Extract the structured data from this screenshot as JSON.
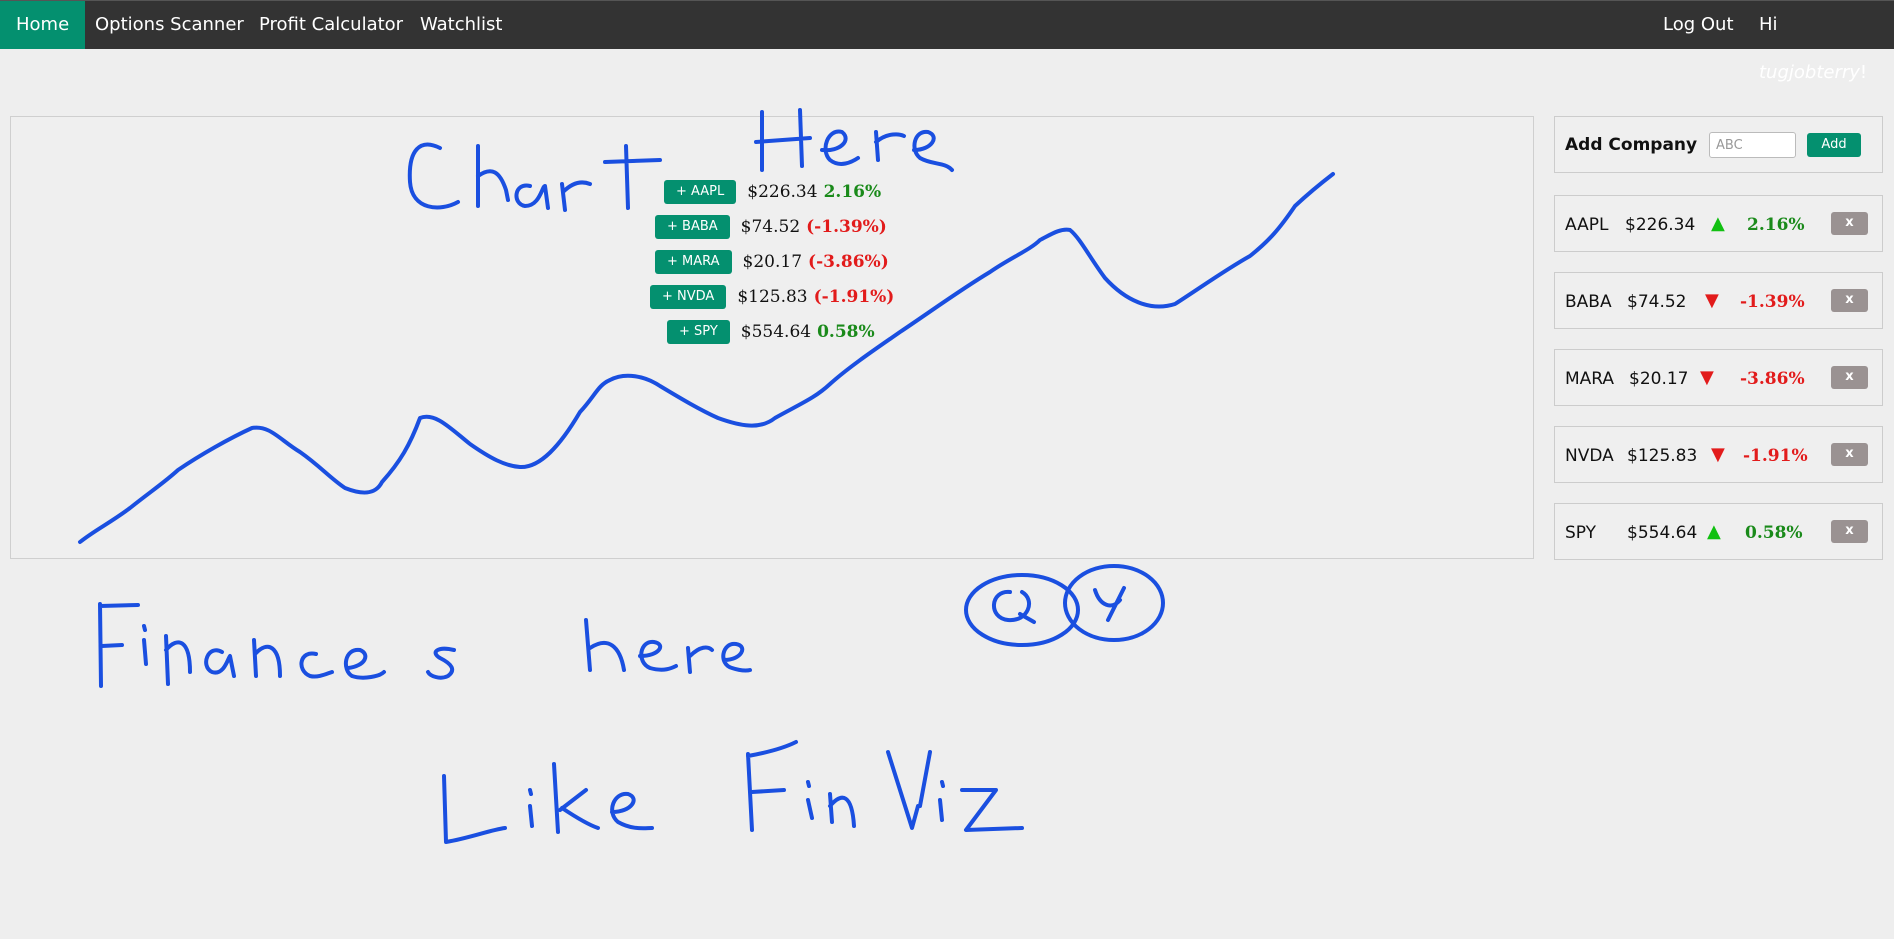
{
  "nav": {
    "home": "Home",
    "options_scanner": "Options Scanner",
    "profit_calculator": "Profit Calculator",
    "watchlist": "Watchlist",
    "logout": "Log Out",
    "greeting_prefix": "Hi ",
    "username": "tugjobterry",
    "greeting_suffix": "!"
  },
  "quick_add": [
    {
      "label": "+ AAPL",
      "price": "$226.34",
      "change": "2.16%",
      "direction": "up"
    },
    {
      "label": "+ BABA",
      "price": "$74.52",
      "change": "(-1.39%)",
      "direction": "down"
    },
    {
      "label": "+ MARA",
      "price": "$20.17",
      "change": "(-3.86%)",
      "direction": "down"
    },
    {
      "label": "+ NVDA",
      "price": "$125.83",
      "change": "(-1.91%)",
      "direction": "down"
    },
    {
      "label": "+ SPY",
      "price": "$554.64",
      "change": "0.58%",
      "direction": "up"
    }
  ],
  "add_company": {
    "title": "Add Company",
    "placeholder": "ABC",
    "button": "Add"
  },
  "watchlist": [
    {
      "symbol": "AAPL",
      "price": "$226.34",
      "arrow": "▲",
      "change": "2.16%",
      "direction": "up",
      "remove": "x"
    },
    {
      "symbol": "BABA",
      "price": "$74.52",
      "arrow": "▼",
      "change": "-1.39%",
      "direction": "down",
      "remove": "x"
    },
    {
      "symbol": "MARA",
      "price": "$20.17",
      "arrow": "▼",
      "change": "-3.86%",
      "direction": "down",
      "remove": "x"
    },
    {
      "symbol": "NVDA",
      "price": "$125.83",
      "arrow": "▼",
      "change": "-1.91%",
      "direction": "down",
      "remove": "x"
    },
    {
      "symbol": "SPY",
      "price": "$554.64",
      "arrow": "▲",
      "change": "0.58%",
      "direction": "up",
      "remove": "x"
    }
  ],
  "handwritten_notes": [
    "Chart Here",
    "Finances here",
    "Like FinViz",
    "Q",
    "Y"
  ],
  "colors": {
    "nav_bg": "#333333",
    "accent": "#04906f",
    "up": "#1a8a1a",
    "down": "#e21b1b",
    "arrow_up": "#11c011",
    "ink": "#1a4fe0"
  }
}
